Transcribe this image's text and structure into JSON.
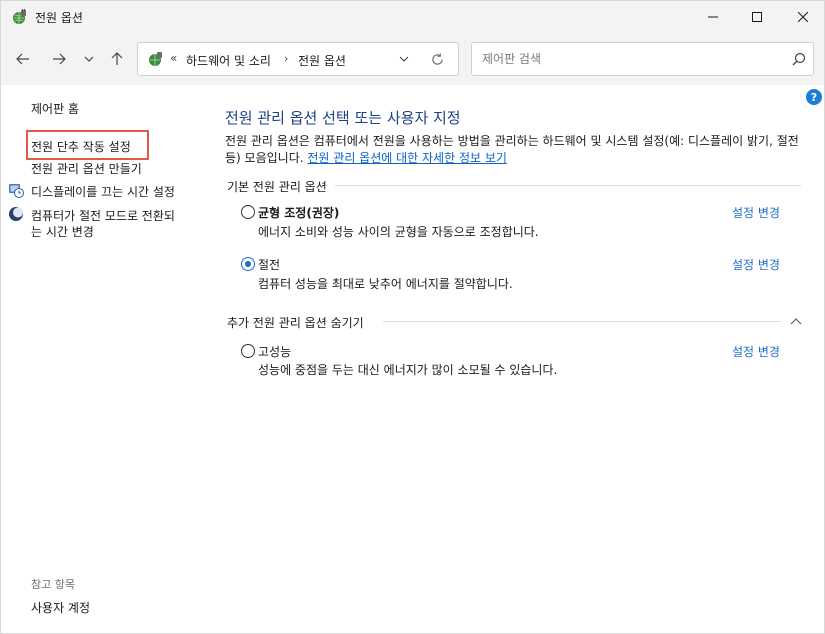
{
  "window": {
    "title": "전원 옵션",
    "icon": "power-options-icon"
  },
  "nav": {
    "back_icon": "arrow-left-icon",
    "forward_icon": "arrow-right-icon",
    "recent_icon": "chevron-down-icon",
    "up_icon": "arrow-up-icon",
    "address": {
      "prefix": "«",
      "crumbs": [
        "하드웨어 및 소리",
        "전원 옵션"
      ],
      "separator": "›"
    },
    "search": {
      "placeholder": "제어판 검색",
      "value": ""
    }
  },
  "left_pane": {
    "home": "제어판 홈",
    "links": [
      "전원 단추 작동 설정",
      "전원 관리 옵션 만들기",
      "디스플레이를 끄는 시간 설정",
      "컴퓨터가 절전 모드로 전환되",
      "는 시간 변경"
    ],
    "see_also_heading": "참고 항목",
    "see_also": [
      "사용자 계정"
    ],
    "highlight_color": "#e05a45"
  },
  "main": {
    "title": "전원 관리 옵션 선택 또는 사용자 지정",
    "description": "전원 관리 옵션은 컴퓨터에서 전원을 사용하는 방법을 관리하는 하드웨어 및 시스템 설정(예: 디스플레이 밝기, 절전 등) 모음입니다.",
    "description_link": "전원 관리 옵션에 대한 자세한 정보 보기",
    "section_basic": "기본 전원 관리 옵션",
    "section_additional": "추가 전원 관리 옵션 숨기기",
    "plans": [
      {
        "name": "균형 조정(권장)",
        "desc": "에너지 소비와 성능 사이의 균형을 자동으로 조정합니다.",
        "change": "설정 변경",
        "selected": false
      },
      {
        "name": "절전",
        "desc": "컴퓨터 성능을 최대로 낮추어 에너지를 절약합니다.",
        "change": "설정 변경",
        "selected": true
      },
      {
        "name": "고성능",
        "desc": "성능에 중점을 두는 대신 에너지가 많이 소모될 수 있습니다.",
        "change": "설정 변경",
        "selected": false
      }
    ],
    "help": "?"
  },
  "colors": {
    "title_blue": "#1e3f8a",
    "link_blue": "#0b62c5",
    "accent_blue": "#1f6bd1",
    "chrome_gray": "#f3f3f3"
  }
}
